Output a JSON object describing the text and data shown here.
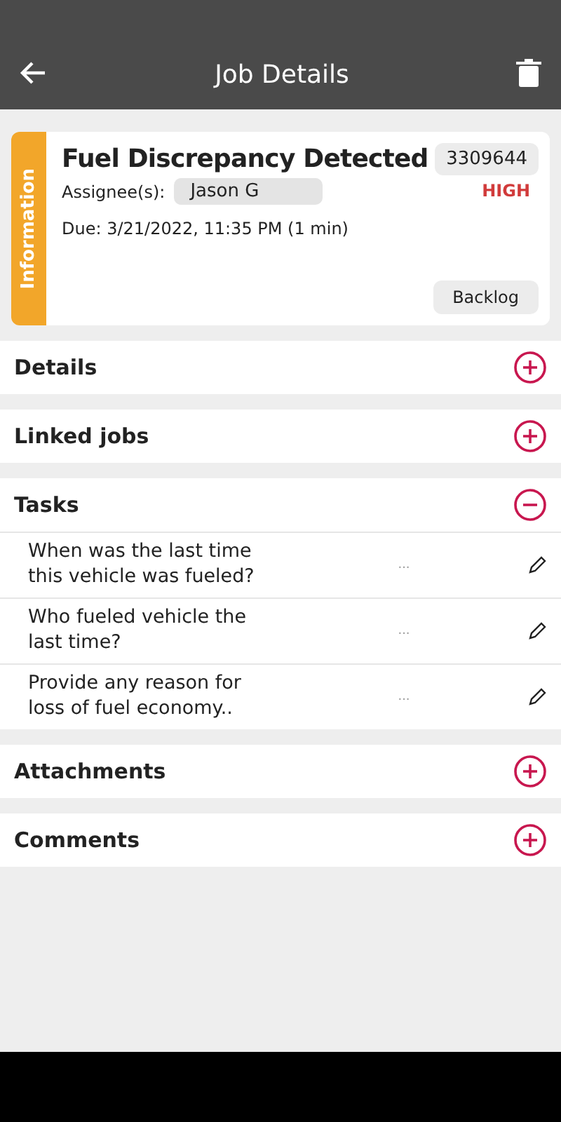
{
  "header": {
    "title": "Job Details"
  },
  "job": {
    "type_label": "Information",
    "title": "Fuel Discrepancy Detected",
    "number": "3309644",
    "assignee_label": "Assignee(s):",
    "assignee": "Jason G",
    "priority": "HIGH",
    "due": "Due: 3/21/2022, 11:35 PM (1 min)",
    "status": "Backlog"
  },
  "sections": [
    {
      "title": "Details",
      "expanded": false
    },
    {
      "title": "Linked jobs",
      "expanded": false
    },
    {
      "title": "Tasks",
      "expanded": true,
      "tasks": [
        {
          "question": "When was the last time this vehicle was fueled?",
          "answer": "..."
        },
        {
          "question": "Who fueled vehicle the last time?",
          "answer": "..."
        },
        {
          "question": "Provide any reason for loss of fuel economy..",
          "answer": "..."
        }
      ]
    },
    {
      "title": "Attachments",
      "expanded": false
    },
    {
      "title": "Comments",
      "expanded": false
    }
  ]
}
